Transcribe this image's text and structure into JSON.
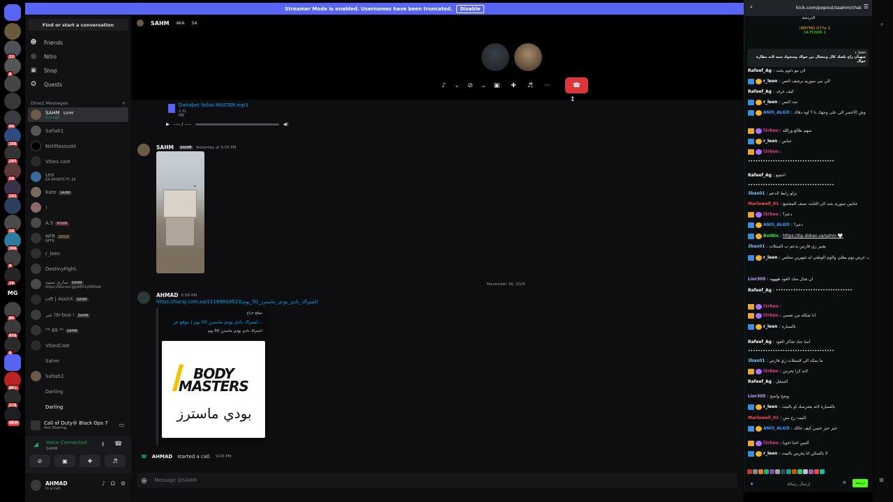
{
  "banner": {
    "text": "Streamer Mode is enabled. Usernames have been truncated.",
    "disable_label": "Disable"
  },
  "sidebar": {
    "finder_placeholder": "Find or start a conversation",
    "nav": [
      {
        "label": "Friends",
        "icon": "friends-icon"
      },
      {
        "label": "Nitro",
        "icon": "nitro-icon"
      },
      {
        "label": "Shop",
        "icon": "shop-icon"
      },
      {
        "label": "Quests",
        "icon": "quests-icon"
      }
    ],
    "dm_header": "Direct Messages",
    "dm_add": "+",
    "dms": [
      {
        "name": "SAHM",
        "tag": "SAHM",
        "sub": "In a call",
        "selected": true
      },
      {
        "name": "Safiah1",
        "tag": "",
        "sub": ""
      },
      {
        "name": "NotMasoudd",
        "tag": "",
        "sub": ""
      },
      {
        "name": "Vibes cast",
        "tag": "",
        "sub": ""
      },
      {
        "name": "Leo",
        "tag": "",
        "sub": "EA SPORTS FC 26"
      },
      {
        "name": "Kate",
        "tag": "SAHM",
        "sub": ""
      },
      {
        "name": "!",
        "tag": "",
        "sub": ""
      },
      {
        "name": "A.S",
        "tag": "POWR",
        "sub": ""
      },
      {
        "name": "NFR",
        "tag": "GOLD",
        "sub": "NFFR"
      },
      {
        "name": "r_leen",
        "tag": "",
        "sub": ""
      },
      {
        "name": "DestinyFight.",
        "tag": "",
        "sub": ""
      },
      {
        "name": "ساري ستيد",
        "tag": "SAHM",
        "sub": "https://discord.gg/eRX2yUN5wb"
      },
      {
        "name": "ᔕᗰ | AssirX",
        "tag": "SAHM",
        "sub": ""
      },
      {
        "name": "عبر l3r-boo !",
        "tag": "SAHM",
        "sub": ""
      },
      {
        "name": "ᴹᴿ 89 ⁸⁹",
        "tag": "SAHM",
        "sub": ""
      },
      {
        "name": "VibesCast",
        "tag": "",
        "sub": ""
      },
      {
        "name": "Sahm",
        "tag": "",
        "sub": ""
      },
      {
        "name": "Safiah2",
        "tag": "",
        "sub": ""
      },
      {
        "name": "Darling",
        "tag": "",
        "sub": ""
      },
      {
        "name": "Darling",
        "tag": "",
        "sub": ""
      }
    ],
    "game": {
      "title": "Call of Duty® Black Ops 7",
      "sub": "Not Sharing"
    },
    "voice": {
      "status": "Voice Connected",
      "channel": "SAHM"
    },
    "user": {
      "name": "AHMAD",
      "status": "In a call"
    }
  },
  "call": {
    "title": "SAHM",
    "aka_label": "AKA",
    "aka_value": "SA"
  },
  "messages": {
    "file_name": "Dahabet follos MASTER.mp3",
    "file_size": "2.31 MB",
    "audio_time": "-:-- / -:--",
    "msg1_author": "SAHM",
    "msg1_tag": "SAHM",
    "msg1_time": "Yesterday at 9:55 PM",
    "date_divider": "November 16, 2025",
    "msg2_author": "AHMAD",
    "msg2_time": "6:58 AM",
    "msg2_link": "https://haraj.com.sa/11169818523/اشتراك_نادي_بودي_ماسترز_50_يوم/",
    "embed_site": "موقع حراج",
    "embed_title": "اشتراك نادي بودي ماسترز 50 يوم | موقع حر...",
    "embed_desc": "اشتراك نادي بودي ماسترز 50 يوم",
    "embed_logo_en": "BODY MASTERS",
    "embed_logo_ar": "بودي ماسترز",
    "call_author": "AHMAD",
    "call_text": "started a call.",
    "call_time": "9:43 PM",
    "input_placeholder": "Message @SAHM"
  },
  "chat": {
    "url": "kick.com/popout/ssahm/chat",
    "title": "الدردشة",
    "stat_top": "I9M7MD  D77e  1",
    "stat_bottom": "14  FDS06  1",
    "pinned_user": "r_leen",
    "pinned_text": "سهيان راح يلعبك كال وبتضال من جواك وسحوك سيه لانه مطارة جوال",
    "send_label": "دردشة",
    "input_placeholder": "إرسال رسالة",
    "lines": [
      {
        "user": "Rafeef_Ag",
        "text": "لان مو دلوم يخت",
        "color": "#ffffff",
        "badge": ""
      },
      {
        "user": "r_leen",
        "text": "الي يبي سوريه يرشف النص",
        "color": "#ffffff",
        "badge": "x"
      },
      {
        "user": "Rafeef_Ag",
        "text": "كيف عرف",
        "color": "#ffffff",
        "badge": ""
      },
      {
        "user": "r_leen",
        "text": "سد النص",
        "color": "#ffffff",
        "badge": "x"
      },
      {
        "user": "ANIS_ALGO",
        "text": "وش الأخضر الي على وجهك نا ؟ أوه دفاك",
        "color": "#39a0ff",
        "badge": "x"
      },
      {
        "user": "l3rboo",
        "text": "سهم طالع ورالله",
        "color": "#e83e8c",
        "badge": "c"
      },
      {
        "user": "r_leen",
        "text": "عباس",
        "color": "#ffffff",
        "badge": "x"
      },
      {
        "user": "l3rboo",
        "text": "",
        "color": "#e83e8c",
        "badge": "c"
      },
      {
        "user": "",
        "text": "•••••••••••••••••••••••••••••••••••",
        "color": "#ffffff",
        "badge": ""
      },
      {
        "user": "Rafeef_Ag",
        "text": "اخشع",
        "color": "#ffffff",
        "badge": ""
      },
      {
        "user": "",
        "text": "•••••••••••••••••••••••••••••••••••",
        "color": "#ffffff",
        "badge": ""
      },
      {
        "user": "3bas01",
        "text": "نزلو رابط الدعم",
        "color": "#7ec3ff",
        "badge": ""
      },
      {
        "user": "Marlowell_01",
        "text": "حتابين سوريه بثت لان الثابت نصف المجتمع",
        "color": "#ff4d4d",
        "badge": ""
      },
      {
        "user": "l3rboo",
        "text": "دعم؟",
        "color": "#e83e8c",
        "badge": "c"
      },
      {
        "user": "ANIS_ALGO",
        "text": "دعم؟",
        "color": "#39a0ff",
        "badge": "x"
      },
      {
        "user": "BotRix",
        "text": "https://tip.dokan.sa/sahm 🤍",
        "color": "#3ee84a",
        "badge": "x"
      },
      {
        "user": "3bas01",
        "text": "يعبير زي فارس بدعم ب الستلات",
        "color": "#7ec3ff",
        "badge": ""
      },
      {
        "user": "r_leen",
        "text": "يحيين كيف عرض يوم يطلي والوم الوطني له شهرين مخلص",
        "color": "#ffffff",
        "badge": "x"
      },
      {
        "user": "Lior305",
        "text": "ان شال منك العود ههههه",
        "color": "#c6a5ff",
        "badge": ""
      },
      {
        "user": "Rafeef_Ag",
        "text": "•••••••••••••••••••••••••••••••",
        "color": "#ffffff",
        "badge": ""
      },
      {
        "user": "l3rboo",
        "text": "",
        "color": "#e83e8c",
        "badge": "c"
      },
      {
        "user": "l3rboo",
        "text": "انا شكله من نفسي",
        "color": "#e83e8c",
        "badge": "c"
      },
      {
        "user": "r_leen",
        "text": "بالسياره",
        "color": "#ffffff",
        "badge": "x"
      },
      {
        "user": "Rafeef_Ag",
        "text": "انما عناد شاكر العود",
        "color": "#ffffff",
        "badge": ""
      },
      {
        "user": "",
        "text": "•••••••••••••••••••••••••••••••••••",
        "color": "#ffffff",
        "badge": ""
      },
      {
        "user": "3bas01",
        "text": "ما يمكه الي الستلات زي فارس",
        "color": "#7ec3ff",
        "badge": ""
      },
      {
        "user": "l3rboo",
        "text": "لانه كرا يحرس",
        "color": "#e83e8c",
        "badge": "c"
      },
      {
        "user": "Rafeef_Ag",
        "text": "السحل",
        "color": "#ffffff",
        "badge": ""
      },
      {
        "user": "Lior305",
        "text": "وضح واصح",
        "color": "#c6a5ff",
        "badge": ""
      },
      {
        "user": "r_leen",
        "text": "بالسياره لانه يتحرسك او بالبيت",
        "color": "#ffffff",
        "badge": "x"
      },
      {
        "user": "Marlowell_01",
        "text": "البيت رح بس",
        "color": "#ff4d4d",
        "badge": ""
      },
      {
        "user": "ANIS_ALGO",
        "text": "حيز حيز حسن كيف حالك",
        "color": "#39a0ff",
        "badge": "x"
      },
      {
        "user": "l3rboo",
        "text": "ألبس احنا اخوبا",
        "color": "#e83e8c",
        "badge": "c"
      },
      {
        "user": "r_leen",
        "text": "لا بالسكن انا يحرس بالبيت",
        "color": "#ffffff",
        "badge": "x"
      }
    ]
  },
  "colors": {
    "accent": "#5865f2",
    "end_call": "#da373c",
    "voice": "#23a55a",
    "kick": "#53fc18",
    "link": "#00a8fc"
  }
}
